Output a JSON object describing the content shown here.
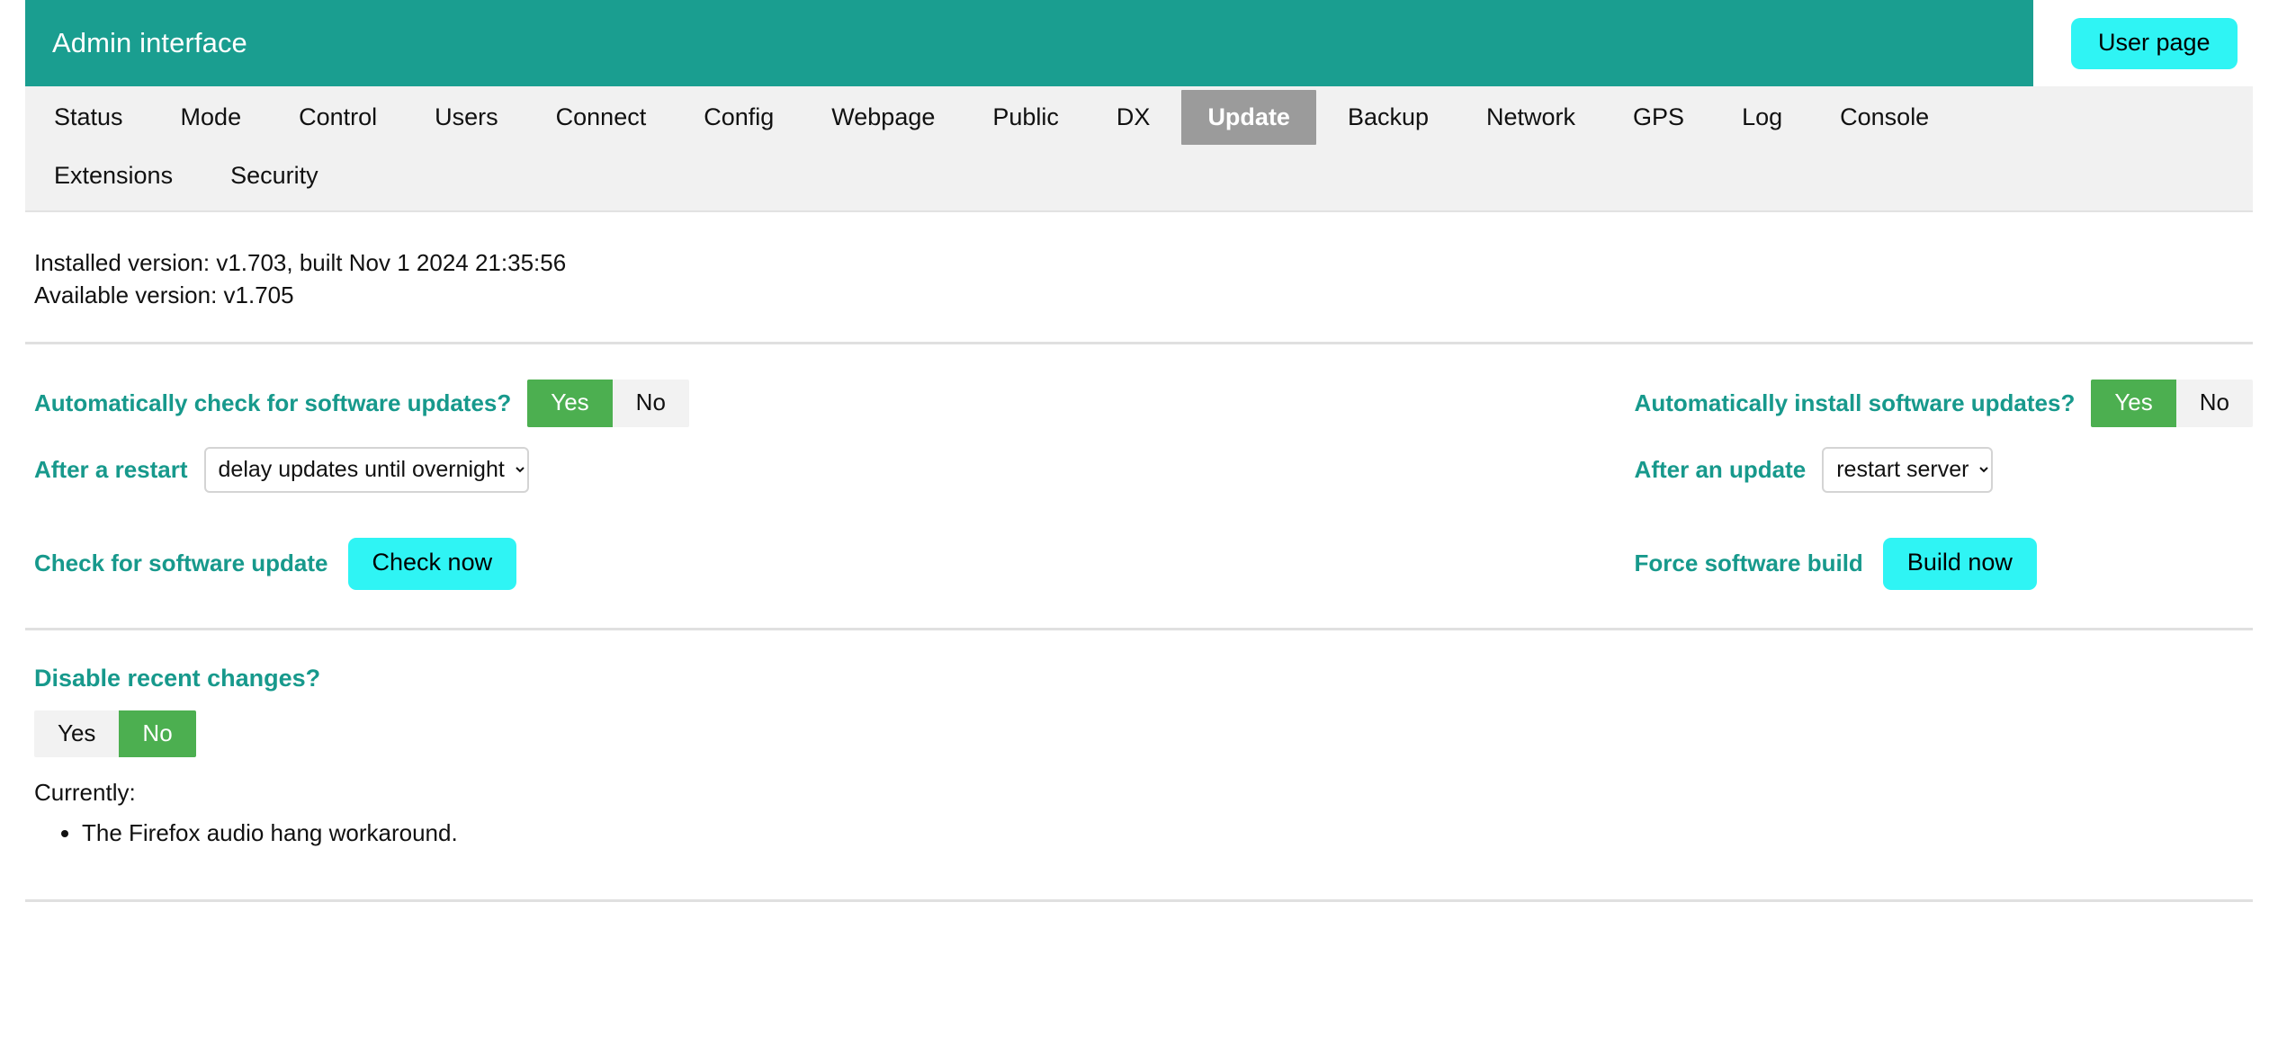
{
  "header": {
    "title": "Admin interface",
    "user_page_button": "User page"
  },
  "nav": {
    "row1": [
      {
        "label": "Status",
        "active": false
      },
      {
        "label": "Mode",
        "active": false
      },
      {
        "label": "Control",
        "active": false
      },
      {
        "label": "Users",
        "active": false
      },
      {
        "label": "Connect",
        "active": false
      },
      {
        "label": "Config",
        "active": false
      },
      {
        "label": "Webpage",
        "active": false
      },
      {
        "label": "Public",
        "active": false
      },
      {
        "label": "DX",
        "active": false
      },
      {
        "label": "Update",
        "active": true
      },
      {
        "label": "Backup",
        "active": false
      },
      {
        "label": "Network",
        "active": false
      },
      {
        "label": "GPS",
        "active": false
      },
      {
        "label": "Log",
        "active": false
      },
      {
        "label": "Console",
        "active": false
      }
    ],
    "row2": [
      {
        "label": "Extensions",
        "active": false
      },
      {
        "label": "Security",
        "active": false
      }
    ]
  },
  "version": {
    "installed": "Installed version: v1.703, built Nov 1 2024 21:35:56",
    "available": "Available version: v1.705"
  },
  "settings": {
    "auto_check": {
      "label": "Automatically check for software updates?",
      "yes": "Yes",
      "no": "No",
      "selected": "Yes"
    },
    "after_restart": {
      "label": "After a restart",
      "value": "delay updates until overnight",
      "options": [
        "delay updates until overnight"
      ]
    },
    "check_update": {
      "label": "Check for software update",
      "button": "Check now"
    },
    "auto_install": {
      "label": "Automatically install software updates?",
      "yes": "Yes",
      "no": "No",
      "selected": "Yes"
    },
    "after_update": {
      "label": "After an update",
      "value": "restart server",
      "options": [
        "restart server"
      ]
    },
    "force_build": {
      "label": "Force software build",
      "button": "Build now"
    }
  },
  "recent_changes": {
    "title": "Disable recent changes?",
    "yes": "Yes",
    "no": "No",
    "selected": "No",
    "currently_label": "Currently:",
    "items": [
      "The Firefox audio hang workaround."
    ]
  },
  "colors": {
    "brand_teal": "#1a9e90",
    "label_teal": "#17998c",
    "toggle_on_green": "#4caf50",
    "action_cyan": "#2ff4f4",
    "active_tab_gray": "#9b9b9b"
  }
}
